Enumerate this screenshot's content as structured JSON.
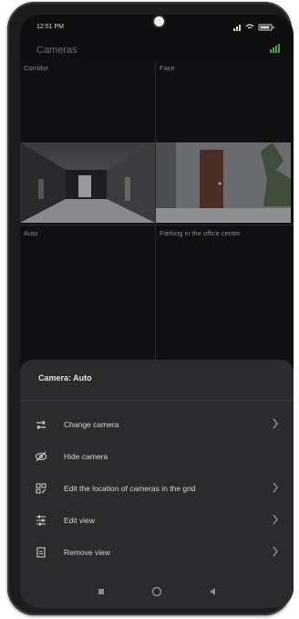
{
  "status_bar": {
    "time": "12:51 PM",
    "icons_text": "◂ ≡ …"
  },
  "header": {
    "title": "Cameras"
  },
  "grid": {
    "cells": [
      {
        "label": "Corridor"
      },
      {
        "label": "Face"
      },
      {
        "label": "Auto"
      },
      {
        "label": "Parking in the office center"
      }
    ]
  },
  "sheet": {
    "title": "Camera: Auto",
    "items": [
      {
        "label": "Change camera",
        "icon": "swap-icon",
        "has_chevron": true
      },
      {
        "label": "Hide camera",
        "icon": "eye-off-icon",
        "has_chevron": false
      },
      {
        "label": "Edit the location of cameras in the grid",
        "icon": "grid-edit-icon",
        "has_chevron": true
      },
      {
        "label": "Edit view",
        "icon": "sliders-icon",
        "has_chevron": true
      },
      {
        "label": "Remove view",
        "icon": "trash-icon",
        "has_chevron": true
      }
    ]
  },
  "colors": {
    "accent_green": "#3fa548",
    "sheet_bg": "#2b2b2e",
    "screen_bg": "#0e0e10"
  }
}
